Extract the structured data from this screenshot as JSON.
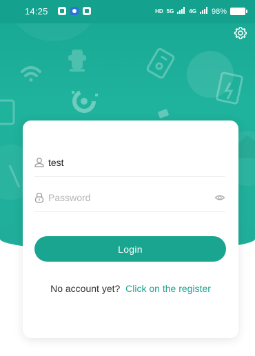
{
  "status_bar": {
    "time": "14:25",
    "hd_tag": "HD",
    "net_5g": "5G",
    "net_4g": "4G",
    "battery": "98%"
  },
  "icons": {
    "settings": "gear-icon",
    "user": "user-icon",
    "lock": "lock-icon",
    "eye": "eye-icon"
  },
  "login_form": {
    "username_value": "test",
    "password_value": "",
    "password_placeholder": "Password",
    "login_label": "Login",
    "no_account_text": "No account yet?",
    "register_link": "Click on the register"
  },
  "colors": {
    "accent": "#1aa590",
    "header_bg": "#1fb29c",
    "card_bg": "#ffffff"
  }
}
